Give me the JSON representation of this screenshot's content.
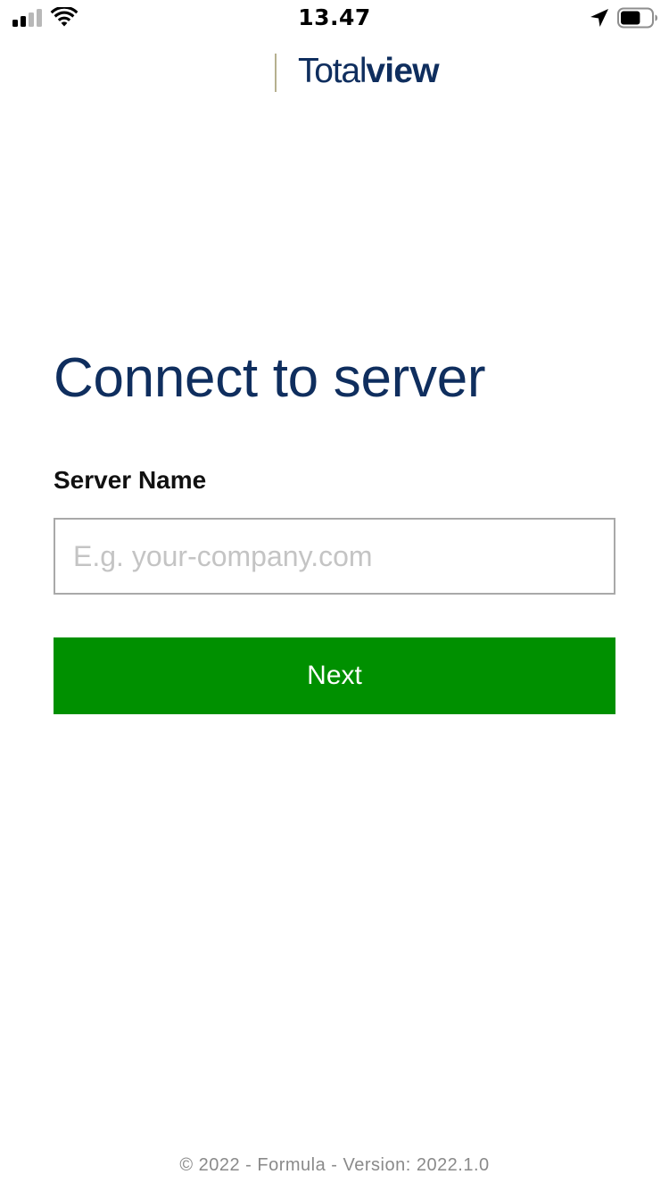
{
  "status_bar": {
    "time": "13.47",
    "signal_icon": "cellular-signal-icon",
    "signal_level": 2,
    "signal_max": 4,
    "wifi_icon": "wifi-icon",
    "location_icon": "location-arrow-icon",
    "battery_icon": "battery-icon",
    "battery_level": 0.65
  },
  "logo": {
    "text_regular": "Total",
    "text_bold": "view",
    "color": "#0f2e5e"
  },
  "main": {
    "title": "Connect to server",
    "server_field": {
      "label": "Server Name",
      "value": "",
      "placeholder": "E.g. your-company.com"
    },
    "next_button": {
      "label": "Next",
      "color": "#009000"
    }
  },
  "footer": {
    "text": "© 2022 - Formula - Version: 2022.1.0"
  }
}
